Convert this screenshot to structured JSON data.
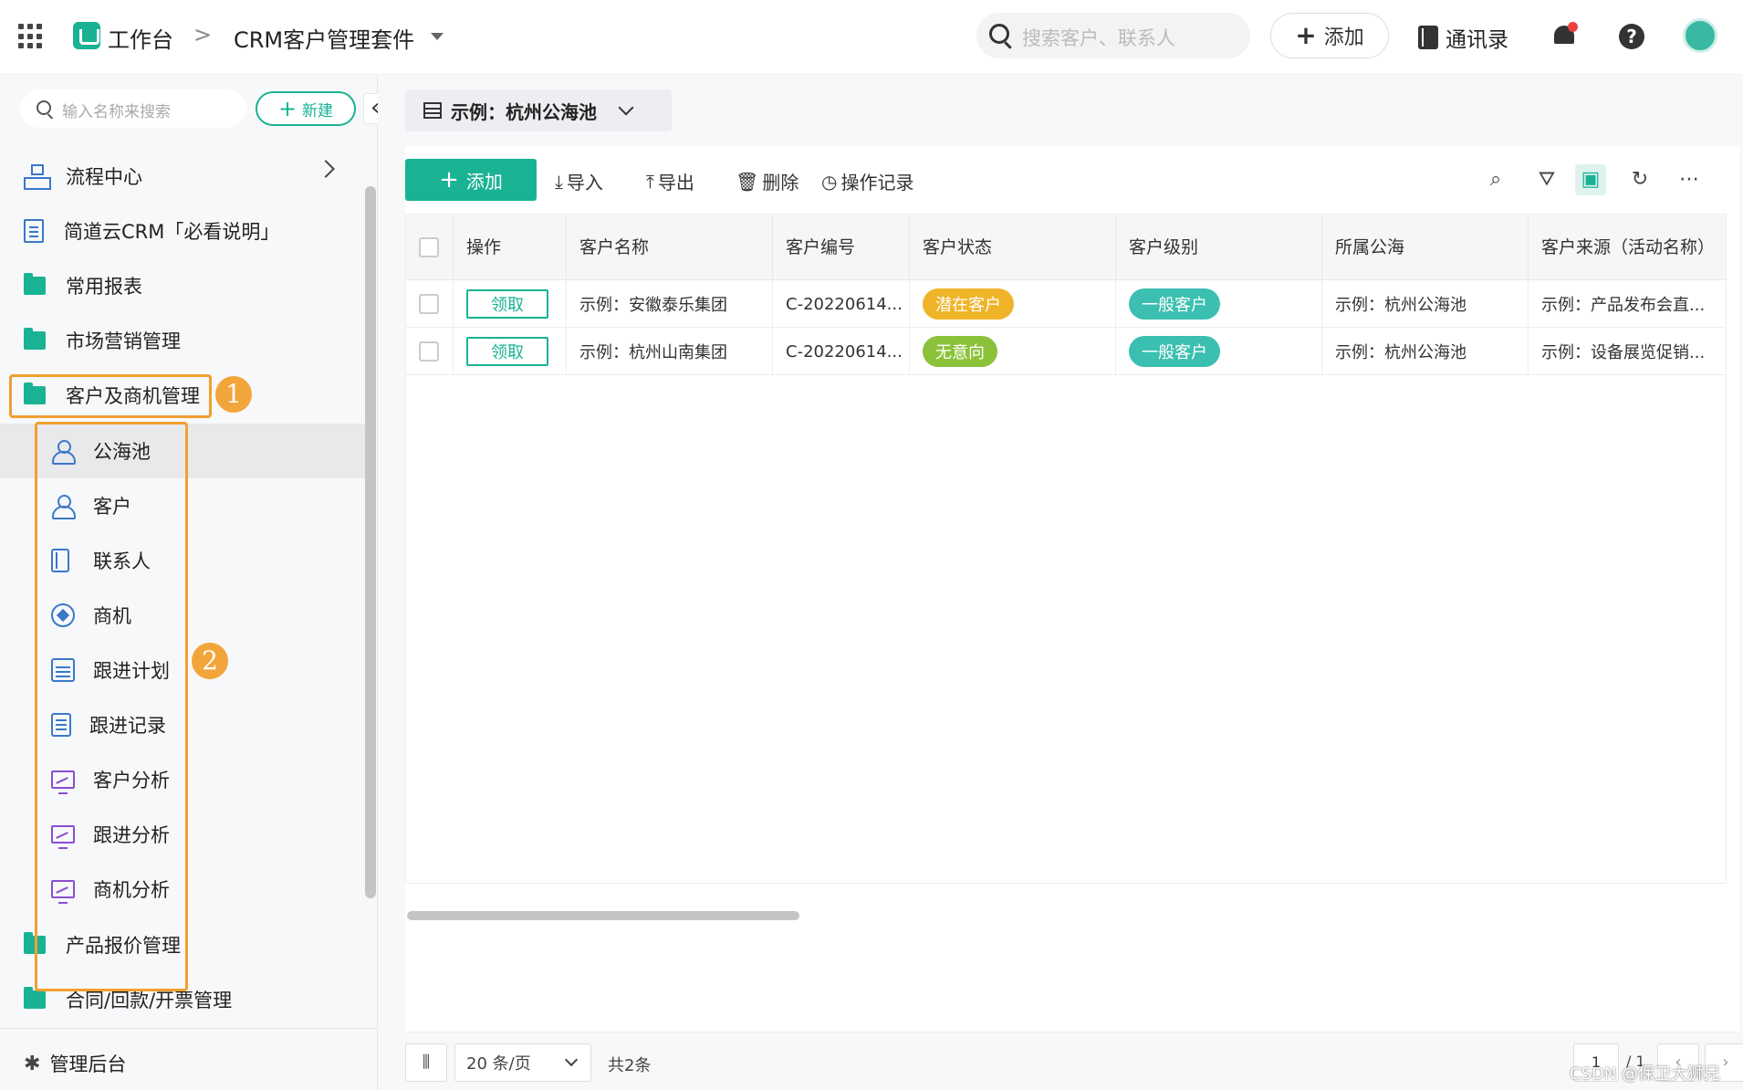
{
  "topbar": {
    "workspace": "工作台",
    "separator": ">",
    "app_name": "CRM客户管理套件",
    "search_placeholder": "搜索客户、联系人",
    "add_label": "添加",
    "contacts_label": "通讯录"
  },
  "sidebar": {
    "search_placeholder": "输入名称来搜索",
    "new_label": "新建",
    "collapse_glyph": "«",
    "items": [
      {
        "label": "流程中心"
      },
      {
        "label": "简道云CRM「必看说明」"
      },
      {
        "label": "常用报表"
      },
      {
        "label": "市场营销管理"
      },
      {
        "label": "客户及商机管理"
      }
    ],
    "sub_items": [
      {
        "label": "公海池",
        "icon": "public-pool-icon"
      },
      {
        "label": "客户",
        "icon": "person-icon"
      },
      {
        "label": "联系人",
        "icon": "contacts-book-icon"
      },
      {
        "label": "商机",
        "icon": "opportunity-icon"
      },
      {
        "label": "跟进计划",
        "icon": "calendar-icon"
      },
      {
        "label": "跟进记录",
        "icon": "record-icon"
      },
      {
        "label": "客户分析",
        "icon": "chart-screen-icon"
      },
      {
        "label": "跟进分析",
        "icon": "chart-screen-icon"
      },
      {
        "label": "商机分析",
        "icon": "chart-screen-icon"
      }
    ],
    "bottom_items": [
      {
        "label": "产品报价管理"
      },
      {
        "label": "合同/回款/开票管理"
      }
    ],
    "admin_label": "管理后台",
    "badges": [
      "1",
      "2"
    ]
  },
  "view": {
    "title": "示例：杭州公海池"
  },
  "toolbar": {
    "add_label": "添加",
    "import_label": "导入",
    "export_label": "导出",
    "delete_label": "删除",
    "log_label": "操作记录"
  },
  "table": {
    "columns": [
      "操作",
      "客户名称",
      "客户编号",
      "客户状态",
      "客户级别",
      "所属公海",
      "客户来源（活动名称）"
    ],
    "rows": [
      {
        "action": "领取",
        "name": "示例：安徽泰乐集团",
        "code": "C-20220614...",
        "status": "潜在客户",
        "status_color": "#f0b429",
        "level": "一般客户",
        "level_color": "#3bbfb0",
        "pool": "示例：杭州公海池",
        "source": "示例：产品发布会直..."
      },
      {
        "action": "领取",
        "name": "示例：杭州山南集团",
        "code": "C-20220614...",
        "status": "无意向",
        "status_color": "#8bc23a",
        "level": "一般客户",
        "level_color": "#3bbfb0",
        "pool": "示例：杭州公海池",
        "source": "示例：设备展览促销..."
      }
    ]
  },
  "footer": {
    "page_size": "20 条/页",
    "total": "共2条",
    "page": "1",
    "pages": "/ 1"
  },
  "watermark": "CSDN @保卫大狮兄",
  "colors": {
    "accent": "#19b394",
    "highlight": "#f0a030"
  }
}
